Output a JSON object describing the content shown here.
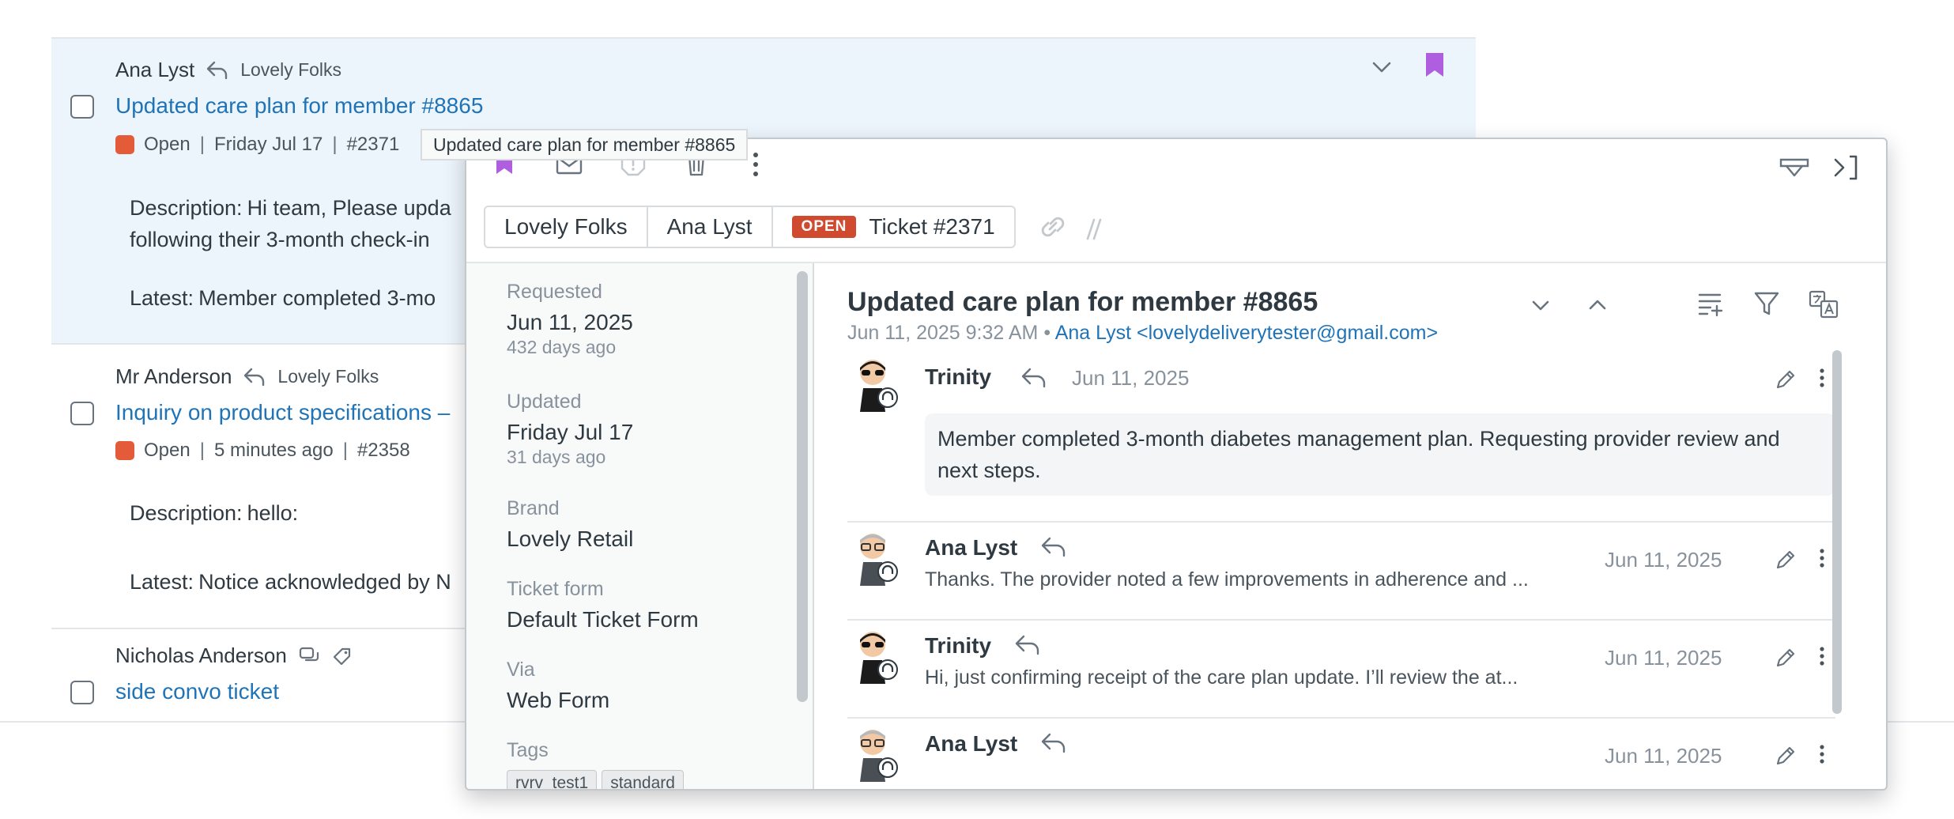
{
  "list": {
    "rows": [
      {
        "requester": "Ana Lyst",
        "brand": "Lovely Folks",
        "subject": "Updated care plan for member #8865",
        "status": "Open",
        "date": "Friday Jul 17",
        "id": "#2371",
        "description_label": "Description:",
        "description_line1": "Hi team, Please upda",
        "description_line2": "following their 3-month check-in",
        "latest_label": "Latest:",
        "latest_text": "Member completed 3-mo"
      },
      {
        "requester": "Mr Anderson",
        "brand": "Lovely Folks",
        "subject": "Inquiry on product specifications –",
        "status": "Open",
        "date": "5 minutes ago",
        "id": "#2358",
        "description_label": "Description:",
        "description_line1": "hello:",
        "latest_label": "Latest:",
        "latest_text": "Notice acknowledged by N"
      },
      {
        "requester": "Nicholas Anderson",
        "subject": "side convo ticket"
      }
    ]
  },
  "tooltip": "Updated care plan for member #8865",
  "panel": {
    "breadcrumbs": {
      "brand": "Lovely Folks",
      "requester": "Ana Lyst",
      "status_pill": "OPEN",
      "ticket": "Ticket #2371"
    },
    "props": {
      "requested_label": "Requested",
      "requested_value": "Jun 11, 2025",
      "requested_sub": "432 days ago",
      "updated_label": "Updated",
      "updated_value": "Friday Jul 17",
      "updated_sub": "31 days ago",
      "brand_label": "Brand",
      "brand_value": "Lovely Retail",
      "form_label": "Ticket form",
      "form_value": "Default Ticket Form",
      "via_label": "Via",
      "via_value": "Web Form",
      "tags_label": "Tags",
      "tags": [
        "rvrv_test1",
        "standard"
      ]
    },
    "conversation": {
      "title": "Updated care plan for member #8865",
      "meta_date": "Jun 11, 2025 9:32 AM",
      "meta_sep": "•",
      "meta_from": "Ana Lyst <lovelydeliverytester@gmail.com>",
      "messages": [
        {
          "author": "Trinity",
          "date": "Jun 11, 2025",
          "body": "Member completed 3-month diabetes management plan. Requesting provider review and next steps."
        },
        {
          "author": "Ana Lyst",
          "date": "Jun 11, 2025",
          "snippet": "Thanks. The provider noted a few improvements in adherence and ..."
        },
        {
          "author": "Trinity",
          "date": "Jun 11, 2025",
          "snippet": "Hi, just confirming receipt of the care plan update. I’ll review the at..."
        },
        {
          "author": "Ana Lyst",
          "date": "Jun 11, 2025"
        }
      ]
    }
  },
  "colors": {
    "link": "#1f73b7",
    "status_open": "#e35b38",
    "bookmark": "#b05ee0",
    "selected_row": "#edf5fc"
  },
  "icons": [
    "reply-icon",
    "bookmark-icon",
    "chevron-down-icon",
    "mail-icon",
    "spam-icon",
    "trash-icon",
    "more-icon",
    "link-icon",
    "split-icon",
    "print-icon",
    "collapse-panel-icon",
    "chevron-up-icon",
    "add-list-icon",
    "filter-icon",
    "translate-icon",
    "edit-icon",
    "side-convo-icon",
    "tag-icon"
  ]
}
